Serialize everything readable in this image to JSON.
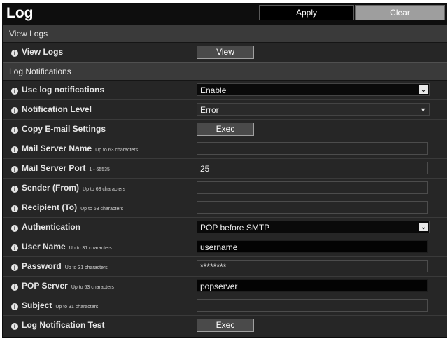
{
  "header": {
    "title": "Log",
    "apply_label": "Apply",
    "clear_label": "Clear"
  },
  "sections": {
    "view_logs": "View Logs",
    "log_notifications": "Log Notifications"
  },
  "view_logs": {
    "label": "View Logs",
    "button": "View"
  },
  "use_log_notifications": {
    "label": "Use log notifications",
    "value": "Enable"
  },
  "notification_level": {
    "label": "Notification Level",
    "value": "Error"
  },
  "copy_email_settings": {
    "label": "Copy E-mail Settings",
    "button": "Exec"
  },
  "mail_server_name": {
    "label": "Mail Server Name",
    "hint": "Up to 63 characters",
    "value": ""
  },
  "mail_server_port": {
    "label": "Mail Server Port",
    "hint": "1 - 65535",
    "value": "25"
  },
  "sender": {
    "label": "Sender (From)",
    "hint": "Up to 63 characters",
    "value": ""
  },
  "recipient": {
    "label": "Recipient (To)",
    "hint": "Up to 63 characters",
    "value": ""
  },
  "authentication": {
    "label": "Authentication",
    "value": "POP before SMTP"
  },
  "user_name": {
    "label": "User Name",
    "hint": "Up to 31 characters",
    "value": "username"
  },
  "password": {
    "label": "Password",
    "hint": "Up to 31 characters",
    "value": "********"
  },
  "pop_server": {
    "label": "POP Server",
    "hint": "Up to 63 characters",
    "value": "popserver"
  },
  "subject": {
    "label": "Subject",
    "hint": "Up to 31 characters",
    "value": ""
  },
  "log_notification_test": {
    "label": "Log Notification Test",
    "button": "Exec"
  },
  "icons": {
    "info": "info-icon",
    "dropdown": "chevron-down-icon"
  }
}
